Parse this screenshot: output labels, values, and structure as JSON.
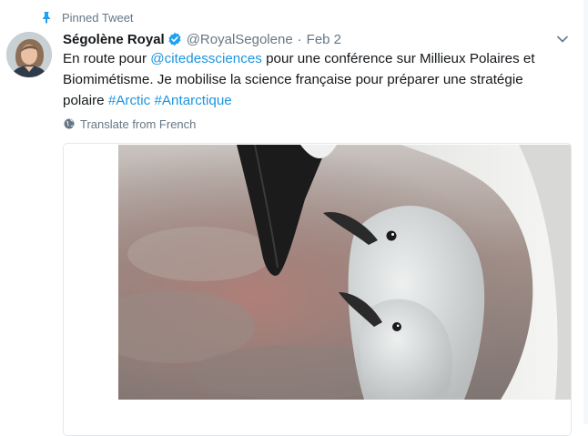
{
  "pinned": {
    "label": "Pinned Tweet",
    "icon": "pin-icon"
  },
  "author": {
    "name": "Ségolène Royal",
    "handle": "@RoyalSegolene",
    "date": "Feb 2",
    "separator": "·",
    "verified_icon": "verified-badge-icon",
    "avatar_icon": "avatar"
  },
  "tweet": {
    "text_before_mention": "En route pour ",
    "mention": "@citedessciences",
    "text_after_mention": " pour une conférence sur Millieux Polaires et Biomimétisme. Je mobilise la science française pour préparer une stratégie polaire ",
    "hashtag_1": "#Arctic",
    "hashtag_2": "#Antarctique"
  },
  "translate": {
    "label": "Translate from French",
    "icon": "globe-icon"
  },
  "menu": {
    "icon": "chevron-down-icon"
  },
  "media": {
    "icon": "photo",
    "subject": "penguin-chicks-photo"
  },
  "colors": {
    "link": "#1b95e0",
    "muted": "#657786",
    "verified": "#1da1f2",
    "pin": "#1da1f2"
  }
}
